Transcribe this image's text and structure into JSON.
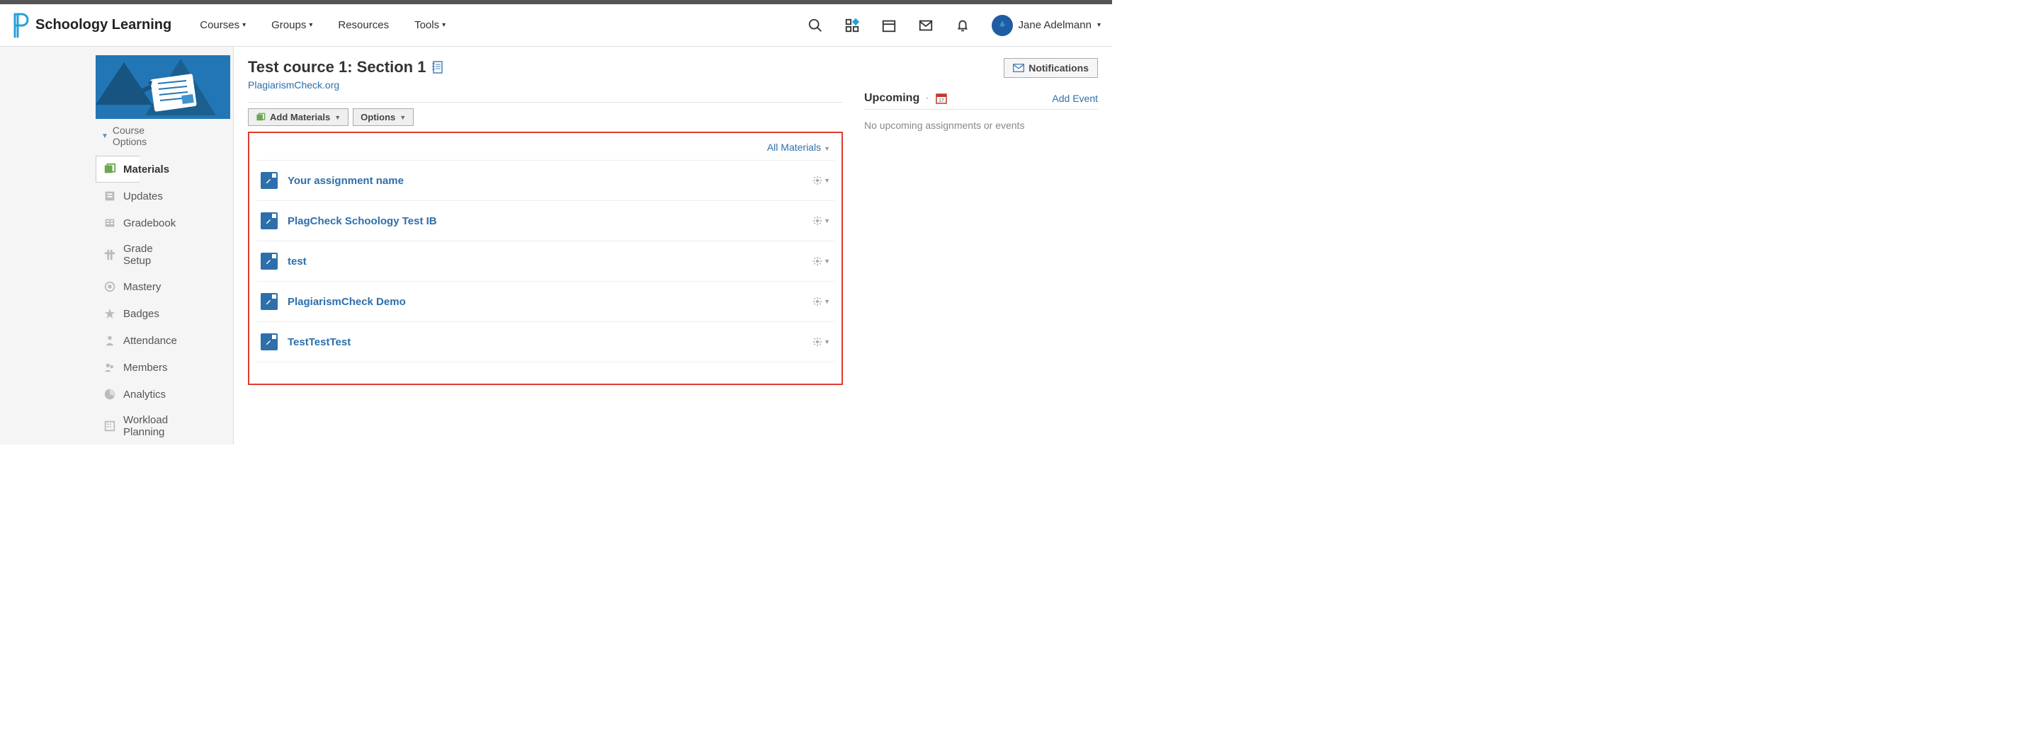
{
  "brand": "Schoology Learning",
  "nav": {
    "courses": "Courses",
    "groups": "Groups",
    "resources": "Resources",
    "tools": "Tools"
  },
  "user": {
    "name": "Jane Adelmann"
  },
  "sidebar": {
    "course_options": "Course Options",
    "items": [
      {
        "label": "Materials"
      },
      {
        "label": "Updates"
      },
      {
        "label": "Gradebook"
      },
      {
        "label": "Grade Setup"
      },
      {
        "label": "Mastery"
      },
      {
        "label": "Badges"
      },
      {
        "label": "Attendance"
      },
      {
        "label": "Members"
      },
      {
        "label": "Analytics"
      },
      {
        "label": "Workload Planning"
      }
    ]
  },
  "course": {
    "title": "Test cource 1: Section 1",
    "org": "PlagiarismCheck.org"
  },
  "toolbar": {
    "add_materials": "Add Materials",
    "options": "Options",
    "all_materials": "All Materials"
  },
  "materials": [
    {
      "title": "Your assignment name"
    },
    {
      "title": "PlagCheck Schoology Test IB"
    },
    {
      "title": "test"
    },
    {
      "title": "PlagiarismCheck Demo"
    },
    {
      "title": "TestTestTest"
    }
  ],
  "right": {
    "notifications": "Notifications",
    "upcoming": "Upcoming",
    "add_event": "Add Event",
    "empty": "No upcoming assignments or events"
  }
}
